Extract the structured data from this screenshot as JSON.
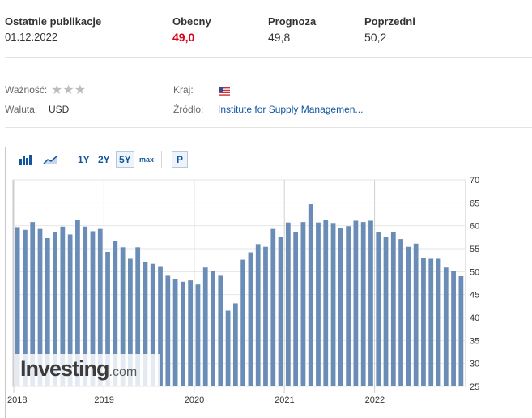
{
  "header": {
    "latest_label": "Ostatnie publikacje",
    "latest_date": "01.12.2022",
    "current_label": "Obecny",
    "current_value": "49,0",
    "forecast_label": "Prognoza",
    "forecast_value": "49,8",
    "previous_label": "Poprzedni",
    "previous_value": "50,2"
  },
  "meta": {
    "importance_label": "Ważność:",
    "importance_stars": 3,
    "currency_label": "Waluta:",
    "currency_value": "USD",
    "country_label": "Kraj:",
    "country_flag_icon": "us-flag-icon",
    "source_label": "Źródło:",
    "source_value": "Institute for Supply Managemen..."
  },
  "toolbar": {
    "bar_icon": "bar-chart-icon",
    "area_icon": "area-chart-icon",
    "ranges": [
      "1Y",
      "2Y",
      "5Y",
      "max"
    ],
    "active_range": "5Y",
    "p_label": "P"
  },
  "watermark": {
    "brand": "Investing",
    "suffix": ".com"
  },
  "colors": {
    "bar": "#6a8db8",
    "current_value": "#d9001b",
    "link": "#1256a0"
  },
  "chart_data": {
    "type": "bar",
    "ylim": [
      25,
      70
    ],
    "y_ticks": [
      25,
      30,
      35,
      40,
      45,
      50,
      55,
      60,
      65,
      70
    ],
    "x_tick_labels": [
      "2018",
      "2019",
      "2020",
      "2021",
      "2022"
    ],
    "grid": true,
    "values": [
      59.7,
      59.1,
      60.8,
      59.3,
      57.3,
      58.7,
      59.8,
      58.1,
      61.3,
      59.8,
      58.8,
      59.3,
      54.3,
      56.6,
      55.3,
      52.8,
      55.3,
      52.1,
      51.7,
      51.2,
      49.1,
      48.3,
      47.8,
      48.1,
      47.2,
      50.9,
      50.1,
      49.1,
      41.5,
      43.1,
      52.6,
      54.2,
      56.0,
      55.4,
      59.3,
      57.5,
      60.7,
      58.7,
      60.8,
      64.7,
      60.7,
      61.2,
      60.6,
      59.5,
      59.9,
      61.1,
      60.8,
      61.1,
      58.6,
      57.6,
      58.6,
      57.1,
      55.4,
      56.1,
      53.0,
      52.8,
      52.8,
      50.9,
      50.2,
      49.0
    ]
  }
}
